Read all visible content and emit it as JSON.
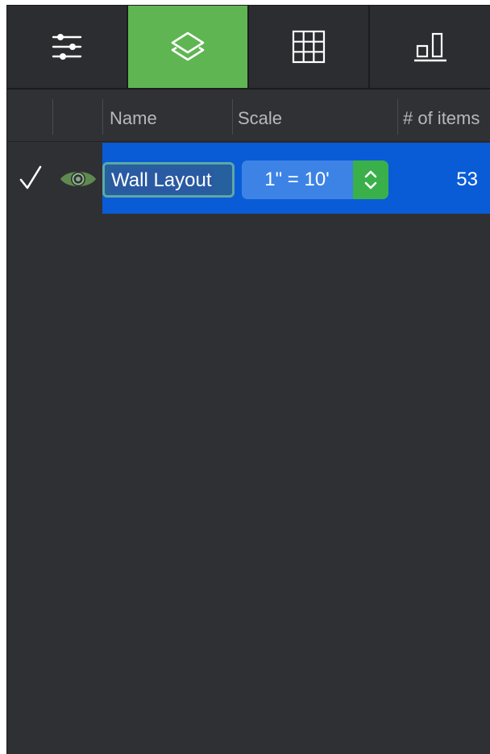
{
  "toolbar": {
    "tabs": [
      {
        "icon": "sliders-icon",
        "active": false
      },
      {
        "icon": "layers-icon",
        "active": true
      },
      {
        "icon": "grid-icon",
        "active": false
      },
      {
        "icon": "bar-chart-icon",
        "active": false
      }
    ],
    "active_color": "#5fb552"
  },
  "table": {
    "columns": {
      "name": "Name",
      "scale": "Scale",
      "items": "# of items"
    },
    "rows": [
      {
        "checked": true,
        "visible": true,
        "name": "Wall Layout",
        "scale": "1\" = 10'",
        "items": "53",
        "selected": true
      }
    ]
  },
  "colors": {
    "selection": "#0a5bd6",
    "panel_bg": "#2f3034",
    "stepper": "#39b04a"
  }
}
